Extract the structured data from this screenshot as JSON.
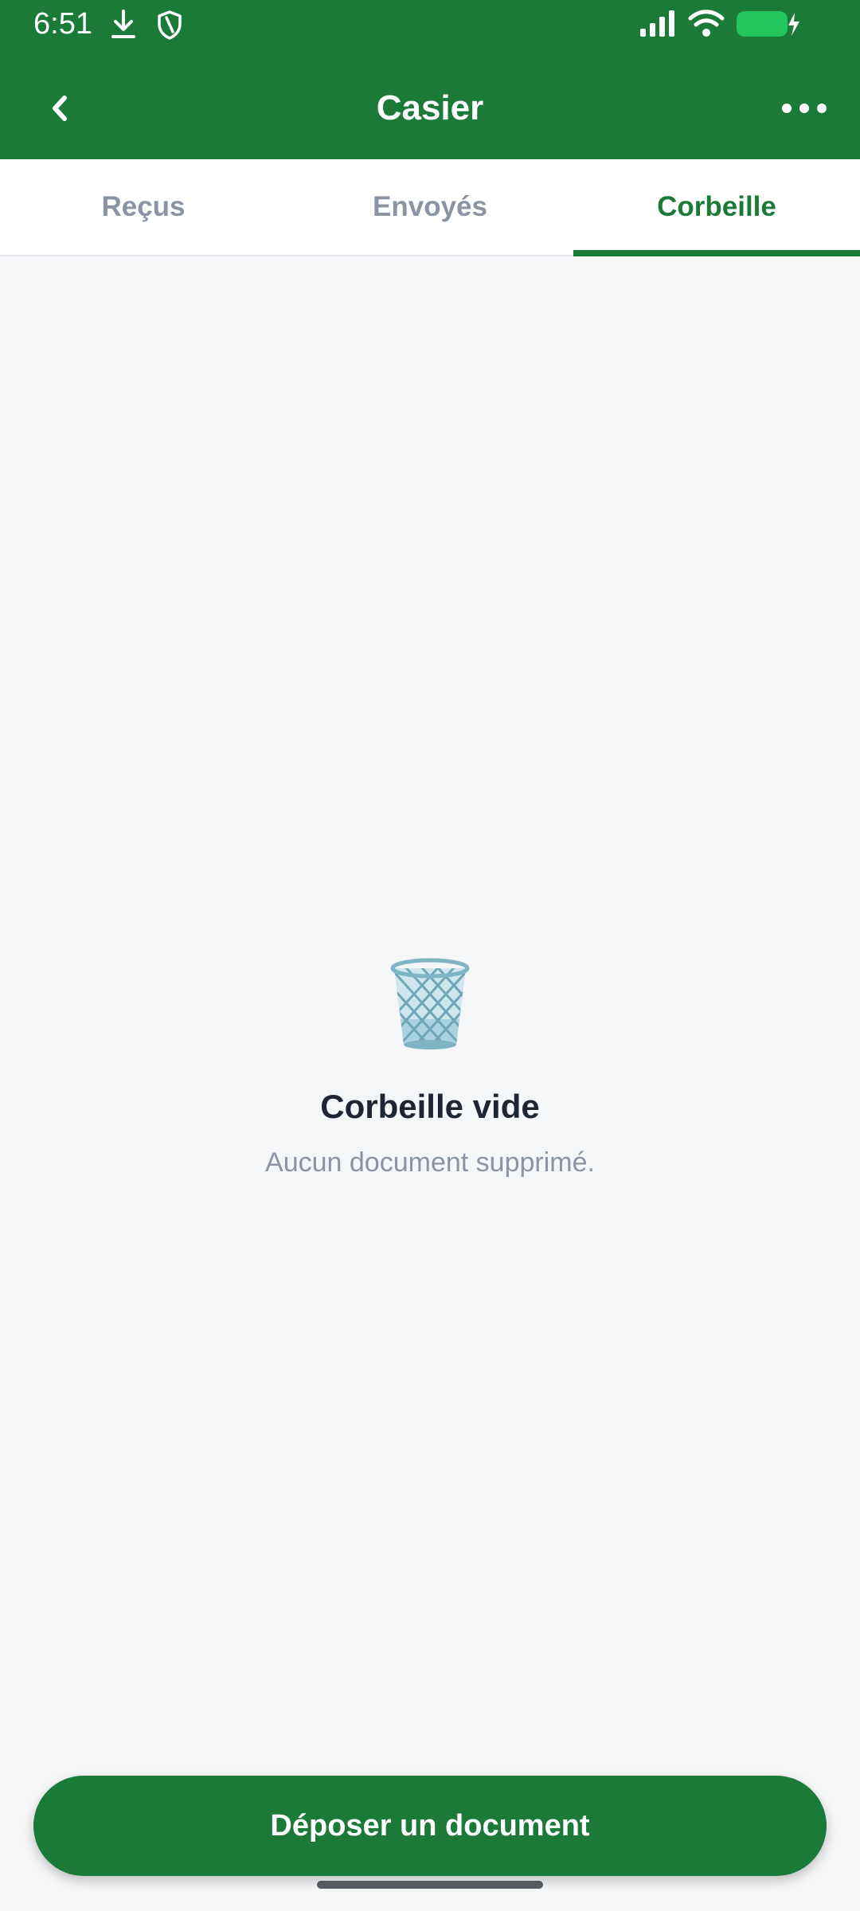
{
  "status_bar": {
    "time": "6:51",
    "icons": [
      "download-icon",
      "shield-icon",
      "signal-icon",
      "wifi-icon",
      "battery-charging-icon"
    ],
    "battery_color": "#22C55E"
  },
  "app_bar": {
    "title": "Casier",
    "back_icon": "chevron-left-icon",
    "more_icon": "more-horizontal-icon"
  },
  "tabs": [
    {
      "label": "Reçus",
      "active": false
    },
    {
      "label": "Envoyés",
      "active": false
    },
    {
      "label": "Corbeille",
      "active": true
    }
  ],
  "empty_state": {
    "icon": "wastebasket-icon",
    "title": "Corbeille vide",
    "subtitle": "Aucun document supprimé."
  },
  "primary_action": {
    "label": "Déposer un document"
  },
  "colors": {
    "brand_green": "#1C7A38",
    "background": "#F5F6F8",
    "tab_inactive": "#8A94A3",
    "title_text": "#1E2633"
  }
}
